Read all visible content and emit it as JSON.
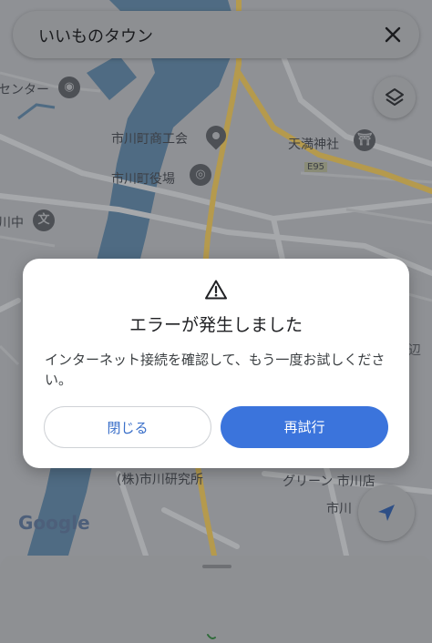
{
  "search": {
    "query": "いいものタウン"
  },
  "map": {
    "labels": {
      "center": "センター",
      "chamber": "市川町商工会",
      "town_office": "市川町役場",
      "shrine": "天満神社",
      "junior_high": "川中",
      "route": "E95",
      "lab": "(株)市川研究所",
      "green": "グリーン 市川店",
      "lower": "市川",
      "edge": "辺"
    },
    "google_logo": "Google"
  },
  "dialog": {
    "title": "エラーが発生しました",
    "message": "インターネット接続を確認して、もう一度お試しください。",
    "close_label": "閉じる",
    "retry_label": "再試行"
  },
  "colors": {
    "primary": "#3b74dc",
    "dialog_bg": "#ffffff",
    "scrim": "#8f9195"
  },
  "icons": {
    "close": "close-icon",
    "layers": "layers-icon",
    "location": "navigation-arrow-icon",
    "warning": "warning-icon"
  }
}
